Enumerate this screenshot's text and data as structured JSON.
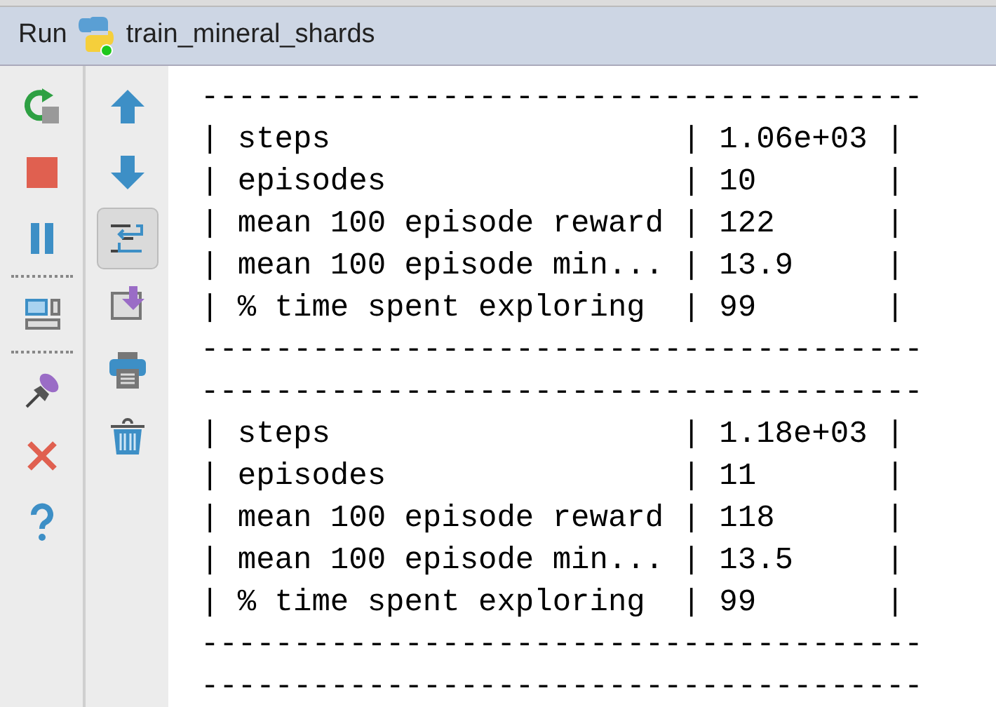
{
  "window": {
    "title_prefix": "Run",
    "config_name": "train_mineral_shards"
  },
  "left_toolbar": [
    {
      "kind": "rerun",
      "pressed": false
    },
    {
      "kind": "stop",
      "pressed": false
    },
    {
      "kind": "pause",
      "pressed": false
    },
    {
      "kind": "separator"
    },
    {
      "kind": "layout",
      "pressed": false
    },
    {
      "kind": "separator"
    },
    {
      "kind": "pin",
      "pressed": false
    },
    {
      "kind": "close",
      "pressed": false
    },
    {
      "kind": "help",
      "pressed": false
    }
  ],
  "right_toolbar": [
    {
      "kind": "up",
      "pressed": false
    },
    {
      "kind": "down",
      "pressed": false
    },
    {
      "kind": "wrap",
      "pressed": true
    },
    {
      "kind": "scroll_end",
      "pressed": false
    },
    {
      "kind": "print",
      "pressed": false
    },
    {
      "kind": "trash",
      "pressed": false
    }
  ],
  "console": {
    "lines": [
      "---------------------------------------",
      "| steps                   | 1.06e+03 |",
      "| episodes                | 10       |",
      "| mean 100 episode reward | 122      |",
      "| mean 100 episode min... | 13.9     |",
      "| % time spent exploring  | 99       |",
      "---------------------------------------",
      "---------------------------------------",
      "| steps                   | 1.18e+03 |",
      "| episodes                | 11       |",
      "| mean 100 episode reward | 118      |",
      "| mean 100 episode min... | 13.5     |",
      "| % time spent exploring  | 99       |",
      "---------------------------------------",
      "---------------------------------------"
    ]
  }
}
